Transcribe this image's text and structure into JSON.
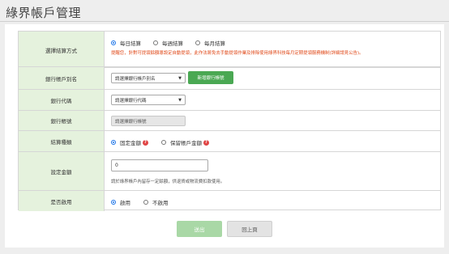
{
  "page": {
    "title": "綠界帳戶管理"
  },
  "settlement": {
    "label": "選擇結算方式",
    "options": [
      "每日結算",
      "每週結算",
      "每月結算"
    ],
    "selected_index": 0,
    "notice": "提醒您，針對可提領餘額導設定自動提領，此作法將免去手動提領作業及排除使用綠界科技每月定期提領服務機制(詳細請見公告)。"
  },
  "alias": {
    "label": "銀行帳戶別名",
    "select_placeholder": "請選擇銀行帳戶別名",
    "add_button": "新增銀行帳號"
  },
  "bank_code": {
    "label": "銀行代碼",
    "select_placeholder": "請選擇銀行代碼"
  },
  "account_number": {
    "label": "銀行帳號",
    "placeholder": "請選擇銀行帳號"
  },
  "amount_type": {
    "label": "結算種類",
    "options": [
      "固定金額",
      "保留帳戶金額"
    ],
    "selected_index": 0
  },
  "set_amount": {
    "label": "設定金額",
    "value": "0",
    "hint": "請於綠界帳戶內留存一定餘額，供退貨或物流費扣款使用。"
  },
  "enabled": {
    "label": "是否啟用",
    "options": [
      "啟用",
      "不啟用"
    ],
    "selected_index": 0
  },
  "actions": {
    "submit": "送出",
    "back": "回上頁"
  },
  "colors": {
    "label_bg": "#e5f2dd",
    "accent_green": "#4aa853",
    "submit_green": "#a9d8a6",
    "notice_red": "#e04a1a"
  }
}
